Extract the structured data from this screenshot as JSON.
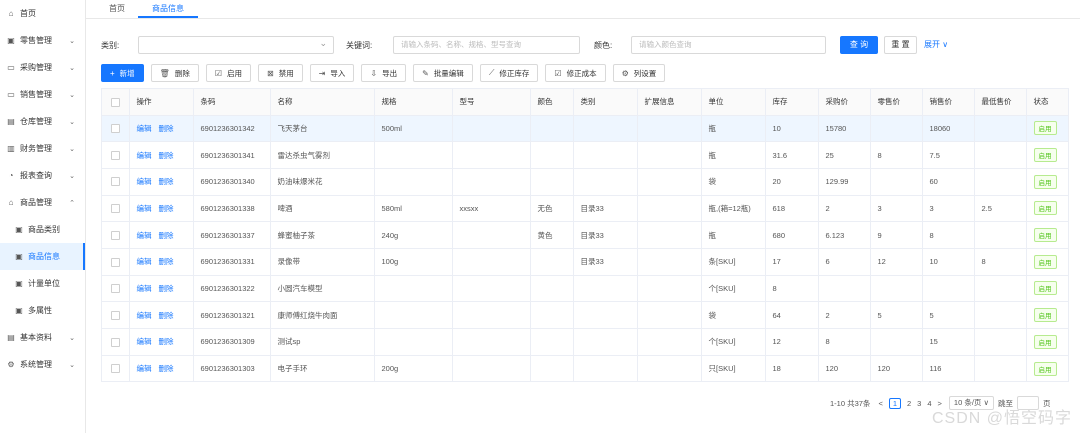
{
  "sidebar": {
    "items": [
      {
        "icon": "home-icon",
        "glyph": "⌂",
        "label": "首页",
        "chevron": ""
      },
      {
        "icon": "retail-icon",
        "glyph": "▣",
        "label": "零售管理",
        "chevron": "⌄"
      },
      {
        "icon": "purchase-icon",
        "glyph": "▭",
        "label": "采购管理",
        "chevron": "⌄"
      },
      {
        "icon": "sales-icon",
        "glyph": "▭",
        "label": "销售管理",
        "chevron": "⌄"
      },
      {
        "icon": "warehouse-icon",
        "glyph": "▤",
        "label": "仓库管理",
        "chevron": "⌄"
      },
      {
        "icon": "finance-icon",
        "glyph": "▥",
        "label": "财务管理",
        "chevron": "⌄"
      },
      {
        "icon": "report-icon",
        "glyph": "◔",
        "label": "报表查询",
        "chevron": "⌄"
      },
      {
        "icon": "goods-icon",
        "glyph": "⌂",
        "label": "商品管理",
        "chevron": "⌃"
      },
      {
        "icon": "category-icon",
        "glyph": "▣",
        "label": "商品类别",
        "chevron": ""
      },
      {
        "icon": "goods-info-icon",
        "glyph": "▣",
        "label": "商品信息",
        "chevron": ""
      },
      {
        "icon": "unit-icon",
        "glyph": "▣",
        "label": "计量单位",
        "chevron": ""
      },
      {
        "icon": "attr-icon",
        "glyph": "▣",
        "label": "多属性",
        "chevron": ""
      },
      {
        "icon": "basic-data-icon",
        "glyph": "▤",
        "label": "基本资料",
        "chevron": "⌄"
      },
      {
        "icon": "system-icon",
        "glyph": "⚙",
        "label": "系统管理",
        "chevron": "⌄"
      }
    ]
  },
  "tabs": [
    {
      "label": "首页"
    },
    {
      "label": "商品信息"
    }
  ],
  "filters": {
    "category_label": "类别:",
    "category_value": "",
    "keyword_label": "关键词:",
    "keyword_placeholder": "请输入条码、名称、规格、型号查询",
    "color_label": "颜色:",
    "color_placeholder": "请输入颜色查询",
    "query_label": "查 询",
    "reset_label": "重 置",
    "expand_label": "展开 ∨"
  },
  "toolbar": [
    {
      "icon": "plus-icon",
      "glyph": "+",
      "label": "新增",
      "primary": true
    },
    {
      "icon": "delete-icon",
      "glyph": "🗑",
      "label": "删除"
    },
    {
      "icon": "enable-icon",
      "glyph": "☑",
      "label": "启用"
    },
    {
      "icon": "disable-icon",
      "glyph": "⊠",
      "label": "禁用"
    },
    {
      "icon": "import-icon",
      "glyph": "⇥",
      "label": "导入"
    },
    {
      "icon": "export-icon",
      "glyph": "⇩",
      "label": "导出"
    },
    {
      "icon": "batch-edit-icon",
      "glyph": "✎",
      "label": "批量编辑"
    },
    {
      "icon": "fix-stock-icon",
      "glyph": "⟋",
      "label": "修正库存"
    },
    {
      "icon": "fix-cost-icon",
      "glyph": "☑",
      "label": "修正成本"
    },
    {
      "icon": "column-settings-icon",
      "glyph": "⚙",
      "label": "列设置"
    }
  ],
  "table": {
    "columns": [
      "",
      "操作",
      "条码",
      "名称",
      "规格",
      "型号",
      "颜色",
      "类别",
      "扩展信息",
      "单位",
      "库存",
      "采购价",
      "零售价",
      "销售价",
      "最低售价",
      "状态"
    ],
    "edit_label": "编辑",
    "delete_label": "删除",
    "rows": [
      {
        "barcode": "6901236301342",
        "name": "飞天茅台",
        "spec": "500ml",
        "model": "",
        "color": "",
        "category": "",
        "ext": "",
        "unit": "瓶",
        "stock": "10",
        "purchase": "15780",
        "retail": "",
        "sale": "18060",
        "min": "",
        "status": "启用"
      },
      {
        "barcode": "6901236301341",
        "name": "雷达杀虫气雾剂",
        "spec": "",
        "model": "",
        "color": "",
        "category": "",
        "ext": "",
        "unit": "瓶",
        "stock": "31.6",
        "purchase": "25",
        "retail": "8",
        "sale": "7.5",
        "min": "",
        "status": "启用"
      },
      {
        "barcode": "6901236301340",
        "name": "奶油味爆米花",
        "spec": "",
        "model": "",
        "color": "",
        "category": "",
        "ext": "",
        "unit": "袋",
        "stock": "20",
        "purchase": "129.99",
        "retail": "",
        "sale": "60",
        "min": "",
        "status": "启用"
      },
      {
        "barcode": "6901236301338",
        "name": "啤酒",
        "spec": "580ml",
        "model": "xxsxx",
        "color": "无色",
        "category": "目录33",
        "ext": "",
        "unit": "瓶,(箱=12瓶)",
        "stock": "618",
        "purchase": "2",
        "retail": "3",
        "sale": "3",
        "min": "2.5",
        "status": "启用"
      },
      {
        "barcode": "6901236301337",
        "name": "蜂蜜柚子茶",
        "spec": "240g",
        "model": "",
        "color": "黄色",
        "category": "目录33",
        "ext": "",
        "unit": "瓶",
        "stock": "680",
        "purchase": "6.123",
        "retail": "9",
        "sale": "8",
        "min": "",
        "status": "启用"
      },
      {
        "barcode": "6901236301331",
        "name": "录像带",
        "spec": "100g",
        "model": "",
        "color": "",
        "category": "目录33",
        "ext": "",
        "unit": "条[SKU]",
        "stock": "17",
        "purchase": "6",
        "retail": "12",
        "sale": "10",
        "min": "8",
        "status": "启用"
      },
      {
        "barcode": "6901236301322",
        "name": "小圆汽车模型",
        "spec": "",
        "model": "",
        "color": "",
        "category": "",
        "ext": "",
        "unit": "个[SKU]",
        "stock": "8",
        "purchase": "",
        "retail": "",
        "sale": "",
        "min": "",
        "status": "启用"
      },
      {
        "barcode": "6901236301321",
        "name": "康师傅红烧牛肉面",
        "spec": "",
        "model": "",
        "color": "",
        "category": "",
        "ext": "",
        "unit": "袋",
        "stock": "64",
        "purchase": "2",
        "retail": "5",
        "sale": "5",
        "min": "",
        "status": "启用"
      },
      {
        "barcode": "6901236301309",
        "name": "测试sp",
        "spec": "",
        "model": "",
        "color": "",
        "category": "",
        "ext": "",
        "unit": "个[SKU]",
        "stock": "12",
        "purchase": "8",
        "retail": "",
        "sale": "15",
        "min": "",
        "status": "启用"
      },
      {
        "barcode": "6901236301303",
        "name": "电子手环",
        "spec": "200g",
        "model": "",
        "color": "",
        "category": "",
        "ext": "",
        "unit": "只[SKU]",
        "stock": "18",
        "purchase": "120",
        "retail": "120",
        "sale": "116",
        "min": "",
        "status": "启用"
      }
    ]
  },
  "pagination": {
    "summary": "1-10 共37条",
    "prev": "<",
    "pages": [
      "1",
      "2",
      "3",
      "4"
    ],
    "current": "1",
    "next": ">",
    "page_size": "10 条/页 ∨",
    "jump_label": "跳至",
    "page_suffix": "页"
  },
  "watermark": "CSDN @悟空码字",
  "colors": {
    "primary": "#1677ff",
    "status_green": "#52c41a"
  }
}
